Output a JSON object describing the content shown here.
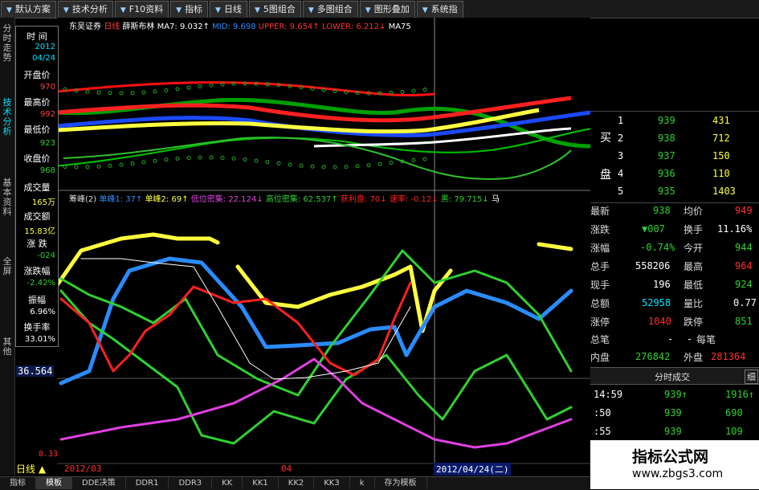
{
  "toolbar": {
    "items": [
      "默认方案",
      "技术分析",
      "F10资料",
      "指标",
      "日线",
      "5图组合",
      "多图组合",
      "图形叠加",
      "系统指"
    ]
  },
  "left_tabs": {
    "items": [
      "分时走势",
      "技术分析",
      "基本资料",
      "全屏",
      "其他"
    ],
    "active_index": 1
  },
  "data_panel": {
    "time_label": "时 间",
    "date_year": "2012",
    "date_md": "04/24",
    "open_label": "开盘价",
    "open_value": "970",
    "high_label": "最高价",
    "high_value": "992",
    "low_label": "最低价",
    "low_value": "923",
    "close_label": "收盘价",
    "close_value": "968",
    "volume_label": "成交量",
    "volume_value": "165万",
    "amount_label": "成交额",
    "amount_value": "15.83亿",
    "change_label": "涨 跌",
    "change_value": "-024",
    "changepct_label": "涨跌幅",
    "changepct_value": "-2.42%",
    "amplitude_label": "振幅",
    "amplitude_value": "6.96%",
    "turnover_label": "换手率",
    "turnover_value": "33.01%"
  },
  "main_chart": {
    "stock_name": "东吴证券",
    "period": "日线",
    "indicator": "薛斯布林",
    "ma7": "MA7: 9.032↑",
    "mid": "MID: 9.698",
    "upper": "UPPER: 9.654↑",
    "lower": "LOWER: 6.212↓",
    "ma75": "MA75"
  },
  "sub_chart": {
    "title": "筹峰(2)",
    "s1": "单峰1: 37↑",
    "s2": "单峰2: 69↑",
    "s3": "低位密集: 22.124↓",
    "s4": "高位密集: 62.537↑",
    "s5": "获利盘: 70↓",
    "s6": "速率: -0.12↓",
    "s7": "黑: 79.715↓",
    "s8": "马"
  },
  "axis": {
    "price_level": "36.564",
    "bottom_value": "8.33",
    "month1": "2012/03",
    "month2": "04",
    "cursor_date": "2012/04/24(二)",
    "period_label": "日线"
  },
  "order_book": {
    "buy_label_1": "买",
    "buy_label_2": "盘",
    "rows": [
      {
        "level": "1",
        "price": "939",
        "volume": "431"
      },
      {
        "level": "2",
        "price": "938",
        "volume": "712"
      },
      {
        "level": "3",
        "price": "937",
        "volume": "150"
      },
      {
        "level": "4",
        "price": "936",
        "volume": "110"
      },
      {
        "level": "5",
        "price": "935",
        "volume": "1403"
      }
    ]
  },
  "quote": {
    "latest_label": "最新",
    "latest": "938",
    "avg_label": "均价",
    "avg": "949",
    "change_label": "涨跌",
    "change": "▼007",
    "turnover_label": "换手",
    "turnover": "11.16%",
    "pct_label": "涨幅",
    "pct": "-0.74%",
    "open_label": "今开",
    "open": "944",
    "total_label": "总手",
    "total": "558206",
    "high_label": "最高",
    "high": "964",
    "now_label": "现手",
    "now": "196",
    "low_label": "最低",
    "low": "924",
    "amount_label": "总额",
    "amount": "52958",
    "ratio_label": "量比",
    "ratio": "0.77",
    "limitup_label": "涨停",
    "limitup": "1040",
    "limitdown_label": "跌停",
    "limitdown": "851",
    "totalbi_label": "总笔",
    "totalbi": "-",
    "perbi_label": "每笔",
    "perbi": "-",
    "inner_label": "内盘",
    "inner": "276842",
    "outer_label": "外盘",
    "outer": "281364"
  },
  "ticks": {
    "title": "分时成交",
    "detail": "细",
    "rows": [
      {
        "time": "14:59",
        "price": "939↑",
        "volume": "1916↑"
      },
      {
        "time": ":50",
        "price": "939",
        "volume": "690"
      },
      {
        "time": ":55",
        "price": "939",
        "volume": "109"
      }
    ]
  },
  "bottom_tabs": {
    "items": [
      "指标",
      "模板",
      "DDE决策",
      "DDR1",
      "DDR3",
      "KK",
      "KK1",
      "KK2",
      "KK3",
      "k",
      "存为模板"
    ],
    "active_index": 1
  },
  "watermark": {
    "title": "指标公式网",
    "url": "www.zbgs3.com"
  },
  "colors": {
    "red": "#ff2020",
    "yellow": "#ffff40",
    "green": "#30d030",
    "blue": "#2a8cff",
    "magenta": "#e040e0",
    "cyan": "#00e5ff"
  }
}
